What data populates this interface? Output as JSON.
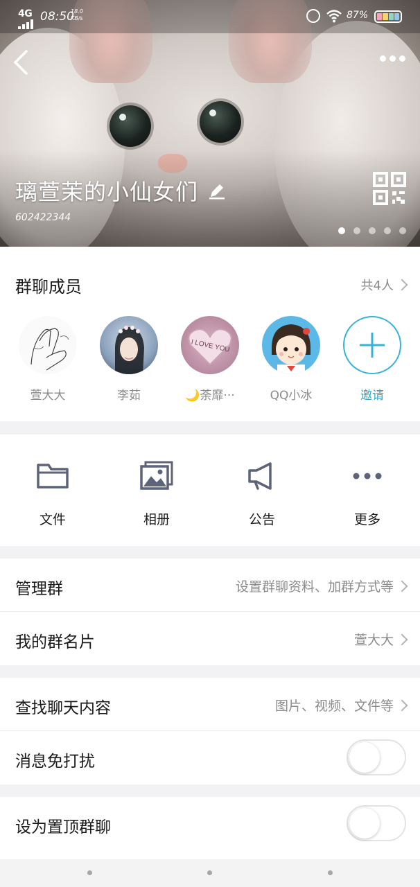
{
  "status_bar": {
    "network": "4G",
    "time": "08:50",
    "speed_value": "18.0",
    "speed_unit": "KB/s",
    "battery_percent": "87%",
    "battery_colors": [
      "#f4a3b9",
      "#f6d36b",
      "#8ed7c6",
      "#8fc7f0"
    ]
  },
  "header": {
    "back_icon": "back-chevron-icon",
    "more_icon": "more-dots-icon",
    "group_name": "璃萱茉的小仙女们",
    "group_id": "602422344",
    "edit_icon": "pencil-icon",
    "qr_icon": "qr-code-icon",
    "carousel_pages": 5,
    "carousel_active_index": 0
  },
  "members": {
    "title": "群聊成员",
    "count_label": "共4人",
    "items": [
      {
        "name": "萱大大",
        "avatar": "sketch-hands-avatar"
      },
      {
        "name": "李茹",
        "avatar": "girl-flower-crown-avatar"
      },
      {
        "name": "🌙荼靡···",
        "avatar": "i-love-you-heart-avatar"
      },
      {
        "name": "QQ小冰",
        "avatar": "cartoon-girl-avatar"
      }
    ],
    "invite_label": "邀请",
    "accent_color": "#35b4d6"
  },
  "actions": [
    {
      "label": "文件",
      "icon": "folder-icon"
    },
    {
      "label": "相册",
      "icon": "photo-album-icon"
    },
    {
      "label": "公告",
      "icon": "megaphone-icon"
    },
    {
      "label": "更多",
      "icon": "more-horizontal-icon"
    }
  ],
  "settings": {
    "manage_label": "管理群",
    "manage_value": "设置群聊资料、加群方式等",
    "card_label": "我的群名片",
    "card_value": "萱大大",
    "search_label": "查找聊天内容",
    "search_value": "图片、视频、文件等",
    "dnd_label": "消息免打扰",
    "dnd_on": false,
    "pin_label": "设为置顶群聊",
    "pin_on": false
  }
}
